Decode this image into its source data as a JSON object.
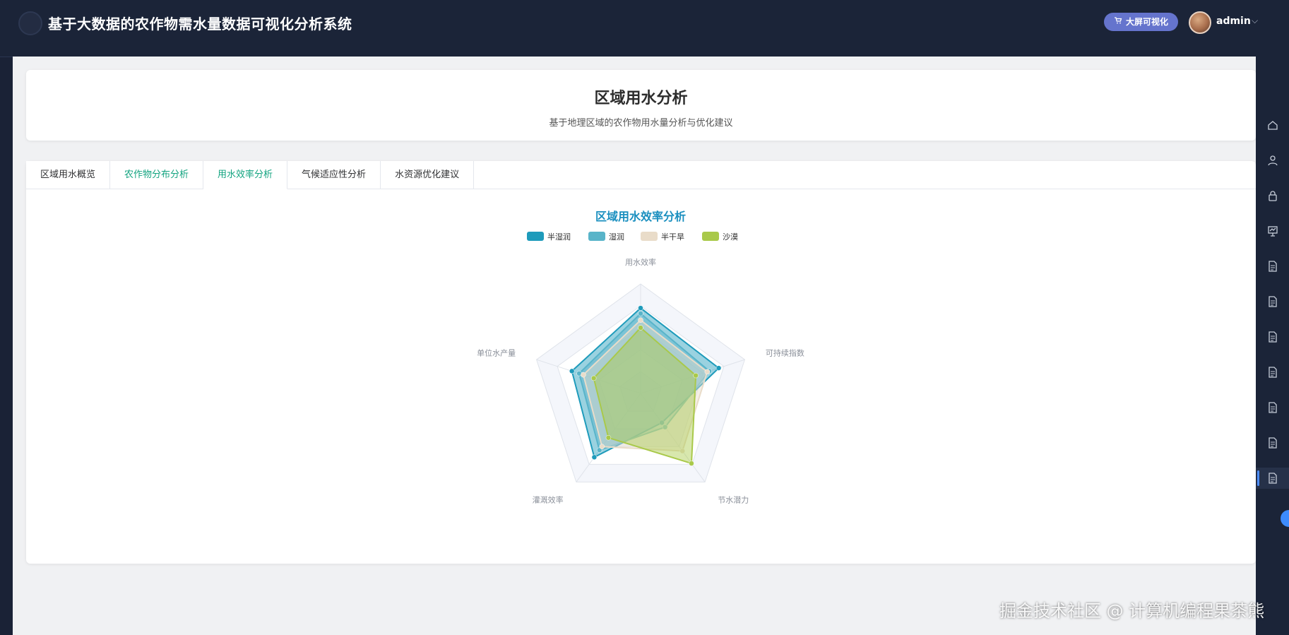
{
  "app": {
    "title": "基于大数据的农作物需水量数据可视化分析系统",
    "bigscreen_label": "大屏可视化",
    "username": "admin"
  },
  "header": {
    "title": "区域用水分析",
    "subtitle": "基于地理区域的农作物用水量分析与优化建议"
  },
  "tabs": [
    {
      "label": "区域用水概览",
      "state": "normal"
    },
    {
      "label": "农作物分布分析",
      "state": "green"
    },
    {
      "label": "用水效率分析",
      "state": "active"
    },
    {
      "label": "气候适应性分析",
      "state": "normal"
    },
    {
      "label": "水资源优化建议",
      "state": "normal"
    }
  ],
  "chart_data": {
    "type": "radar",
    "title": "区域用水效率分析",
    "indicators": [
      "用水效率",
      "可持续指数",
      "节水潜力",
      "灌溉效率",
      "单位水产量"
    ],
    "max": 100,
    "series": [
      {
        "name": "半湿润",
        "color": "#1e9bbb",
        "values": [
          78,
          75,
          33,
          72,
          66
        ]
      },
      {
        "name": "湿润",
        "color": "#59b4c9",
        "values": [
          73,
          66,
          38,
          64,
          59
        ]
      },
      {
        "name": "半干旱",
        "color": "#e9dcc9",
        "values": [
          67,
          64,
          65,
          60,
          55
        ]
      },
      {
        "name": "沙漠",
        "color": "#a9c94a",
        "values": [
          60,
          53,
          79,
          50,
          45
        ]
      }
    ],
    "grid": true,
    "legend_position": "top-center"
  },
  "watermark": "掘金技术社区 @ 计算机编程果茶熊",
  "icons": {
    "rail": [
      "home-icon",
      "user-icon",
      "lock-icon",
      "presentation-icon",
      "document-icon",
      "document-icon",
      "document-icon",
      "document-icon",
      "document-icon",
      "document-icon",
      "document-icon"
    ]
  }
}
